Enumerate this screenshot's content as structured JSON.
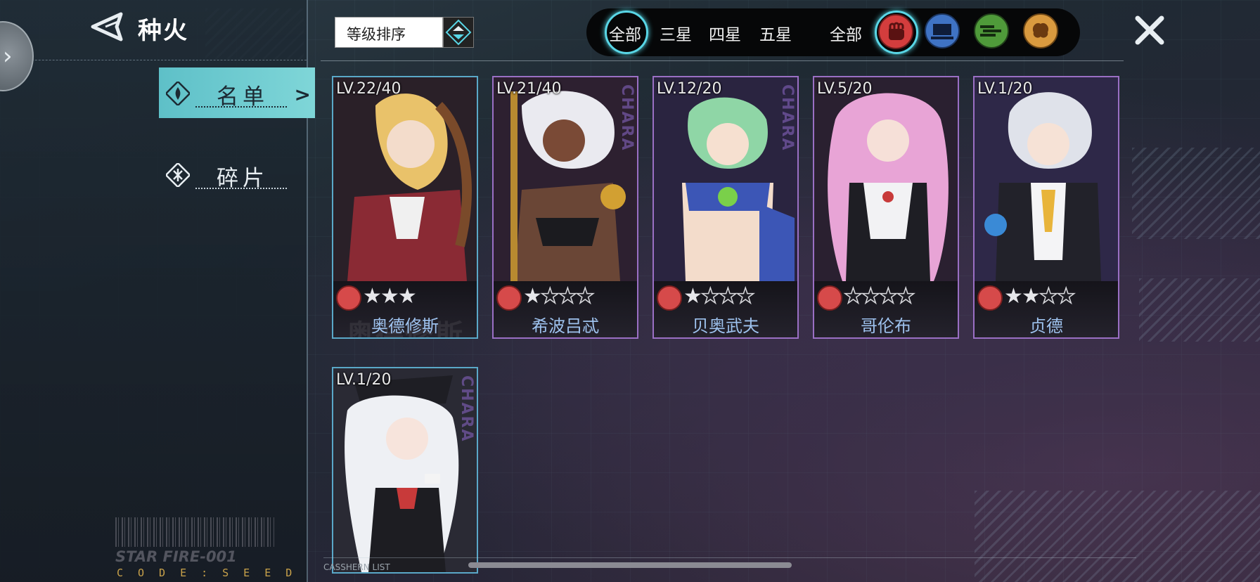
{
  "header": {
    "title": "种火"
  },
  "sidebar": {
    "items": [
      {
        "label": "名单",
        "active": true
      },
      {
        "label": "碎片",
        "active": false
      }
    ],
    "barcode_text": "STAR FIRE-001",
    "code_text": "CODE:SEED"
  },
  "sort": {
    "label": "等级排序"
  },
  "filters": {
    "rarity": [
      "全部",
      "三星",
      "四星",
      "五星"
    ],
    "class_all": "全部",
    "class_icons": [
      "fist-icon",
      "tech-icon",
      "speed-icon",
      "brain-icon"
    ],
    "selected_rarity": "全部",
    "selected_class": "fist-icon"
  },
  "cards": [
    {
      "level": "LV.22/40",
      "name": "奥德修斯",
      "stars_on": 3,
      "stars_total": 3,
      "frame_color": "#5aa8c8"
    },
    {
      "level": "LV.21/40",
      "name": "希波吕忒",
      "stars_on": 1,
      "stars_total": 4,
      "frame_color": "#9a6fc4"
    },
    {
      "level": "LV.12/20",
      "name": "贝奥武夫",
      "stars_on": 1,
      "stars_total": 4,
      "frame_color": "#9a6fc4"
    },
    {
      "level": "LV.5/20",
      "name": "哥伦布",
      "stars_on": 0,
      "stars_total": 4,
      "frame_color": "#9a6fc4"
    },
    {
      "level": "LV.1/20",
      "name": "贞德",
      "stars_on": 2,
      "stars_total": 4,
      "frame_color": "#9a6fc4"
    },
    {
      "level": "LV.1/20",
      "name": "",
      "stars_on": 0,
      "stars_total": 0,
      "frame_color": "#5aa8c8"
    }
  ],
  "card_watermark": "CHARA",
  "list_caption": "CASSHERN LIST",
  "colors": {
    "accent": "#5ec0c8",
    "selected_ring": "#59d6e6",
    "name_text": "#9ec2ee"
  }
}
